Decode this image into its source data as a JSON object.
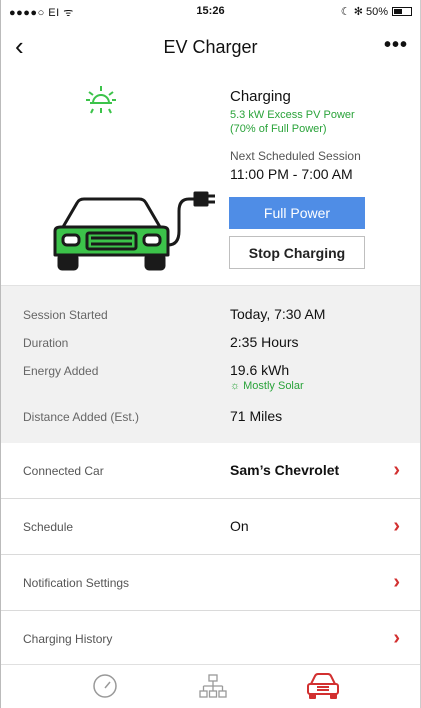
{
  "status_bar": {
    "carrier": "●●●●○ EI ᯤ",
    "time": "15:26",
    "battery_text": "☾ ✻ 50%",
    "battery_level": 0.5
  },
  "nav": {
    "back_icon": "‹",
    "title": "EV Charger",
    "more_icon": "•••"
  },
  "charging": {
    "status_title": "Charging",
    "status_line1": "5.3 kW Excess PV Power",
    "status_line2": "(70% of Full Power)",
    "next_label": "Next Scheduled Session",
    "next_time": "11:00 PM - 7:00 AM",
    "full_power_label": "Full Power",
    "stop_label": "Stop Charging"
  },
  "details": {
    "session_started_label": "Session Started",
    "session_started_value": "Today, 7:30 AM",
    "duration_label": "Duration",
    "duration_value": "2:35 Hours",
    "energy_label": "Energy Added",
    "energy_value": "19.6 kWh",
    "energy_source": "Mostly Solar",
    "distance_label": "Distance Added  (Est.)",
    "distance_value": "71 Miles"
  },
  "list": [
    {
      "label": "Connected Car",
      "value": "Sam’s Chevrolet",
      "chevron": "›"
    },
    {
      "label": "Schedule",
      "value": "On",
      "chevron": "›"
    },
    {
      "label": "Notification Settings",
      "value": "",
      "chevron": "›"
    },
    {
      "label": "Charging History",
      "value": "",
      "chevron": "›"
    }
  ],
  "colors": {
    "accent_blue": "#4f8de6",
    "solar_green": "#2aa33a",
    "car_green": "#3cc34a",
    "chevron_red": "#d23030"
  },
  "tabs": [
    {
      "icon": "gauge-icon",
      "active": false
    },
    {
      "icon": "network-icon",
      "active": false
    },
    {
      "icon": "car-icon",
      "active": true
    }
  ]
}
